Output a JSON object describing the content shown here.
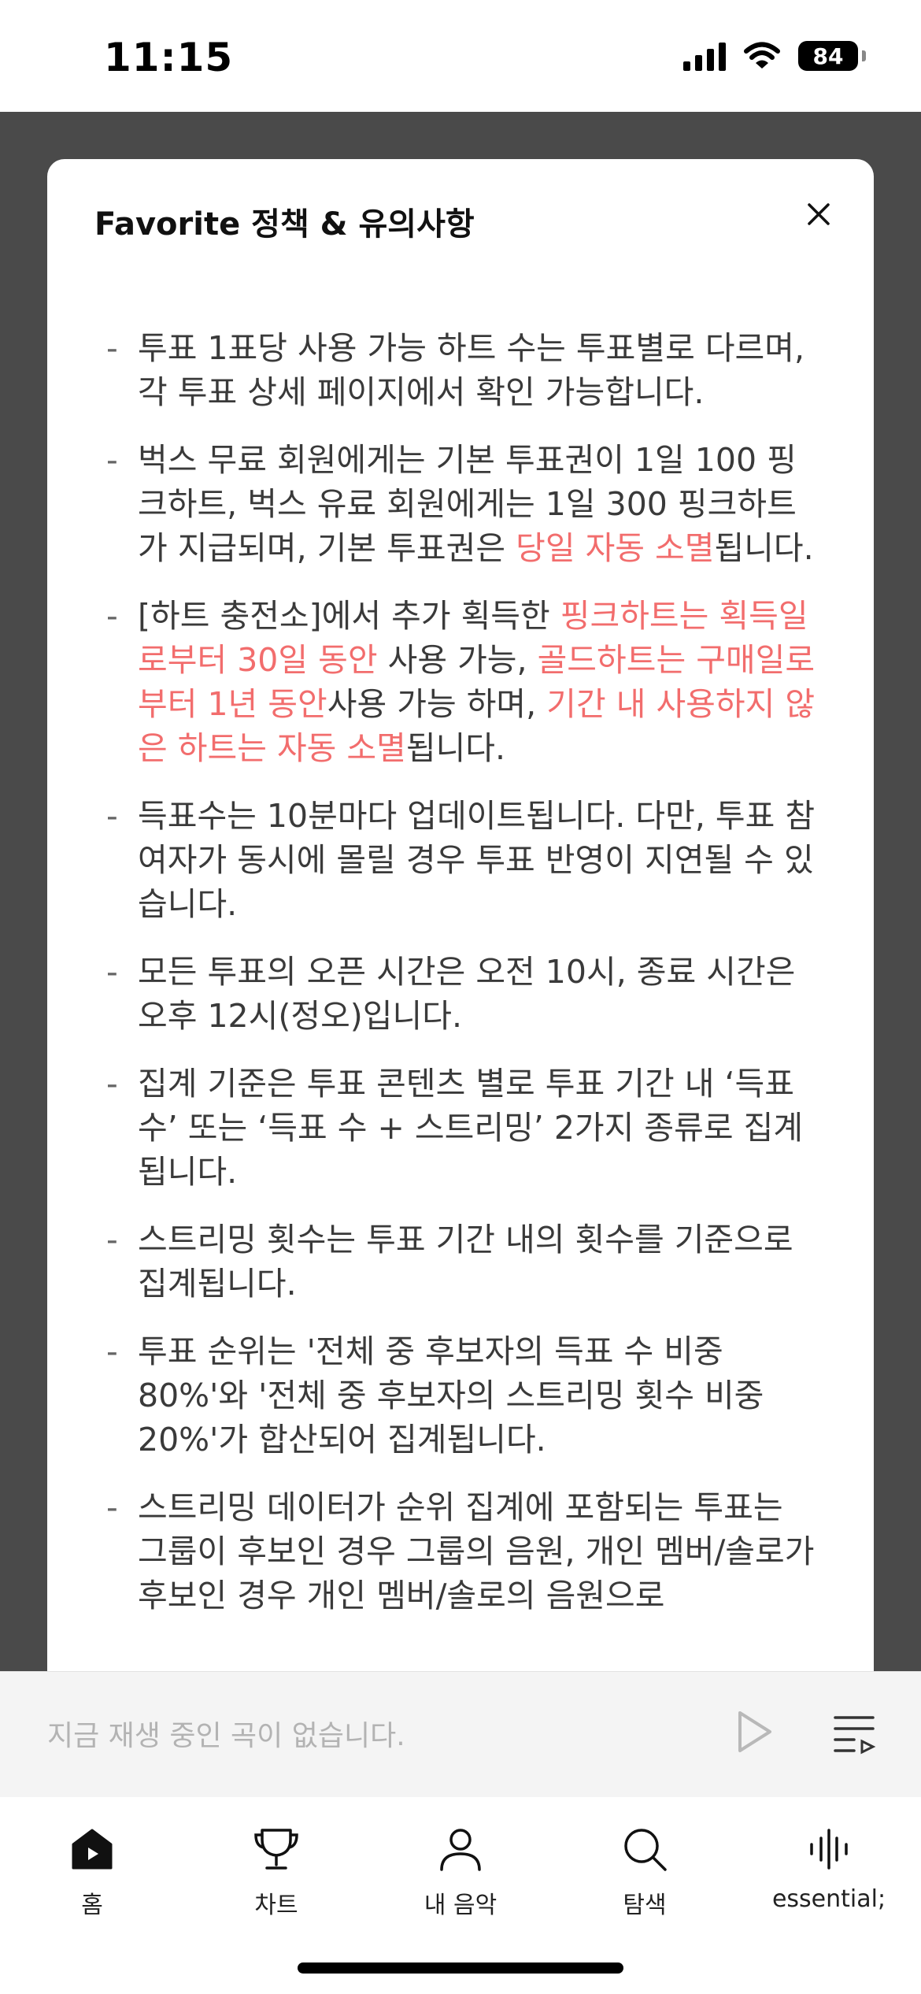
{
  "status_bar": {
    "time": "11:15",
    "battery": "84"
  },
  "modal": {
    "title": "Favorite 정책 & 유의사항",
    "items": [
      [
        {
          "t": "투표 1표당 사용 가능 하트 수는 투표별로 다르며, 각 투표 상세 페이지에서 확인 가능합니다."
        }
      ],
      [
        {
          "t": "벅스 무료 회원에게는 기본 투표권이 1일 100 핑크하트, 벅스 유료 회원에게는 1일 300 핑크하트가 지급되며, 기본 투표권은 "
        },
        {
          "t": "당일 자동 소멸",
          "hl": true
        },
        {
          "t": "됩니다."
        }
      ],
      [
        {
          "t": "[하트 충전소]에서 추가 획득한 "
        },
        {
          "t": "핑크하트는 획득일로부터 30일 동안",
          "hl": true
        },
        {
          "t": " 사용 가능, "
        },
        {
          "t": "골드하트는 구매일로부터 1년 동안",
          "hl": true
        },
        {
          "t": "사용 가능 하며, "
        },
        {
          "t": "기간 내 사용하지 않은 하트는 자동 소멸",
          "hl": true
        },
        {
          "t": "됩니다."
        }
      ],
      [
        {
          "t": "득표수는 10분마다 업데이트됩니다. 다만, 투표 참여자가 동시에 몰릴 경우 투표 반영이 지연될 수 있습니다."
        }
      ],
      [
        {
          "t": "모든 투표의 오픈 시간은 오전 10시, 종료 시간은 오후 12시(정오)입니다."
        }
      ],
      [
        {
          "t": "집계 기준은 투표 콘텐츠 별로 투표 기간 내 ‘득표 수’ 또는 ‘득표 수 + 스트리밍’ 2가지 종류로 집계됩니다."
        }
      ],
      [
        {
          "t": "스트리밍 횟수는 투표 기간 내의 횟수를 기준으로 집계됩니다."
        }
      ],
      [
        {
          "t": "투표 순위는 '전체 중 후보자의 득표 수 비중 80%'와 '전체 중 후보자의 스트리밍 횟수 비중 20%'가 합산되어 집계됩니다."
        }
      ],
      [
        {
          "t": "스트리밍 데이터가 순위 집계에 포함되는 투표는 그룹이 후보인 경우 그룹의 음원, 개인 멤버/솔로가 후보인 경우 개인 멤버/솔로의 음원으로"
        }
      ]
    ]
  },
  "mini_player": {
    "now_playing": "지금 재생 중인 곡이 없습니다."
  },
  "tabs": [
    {
      "label": "홈",
      "icon": "home-icon"
    },
    {
      "label": "차트",
      "icon": "trophy-icon"
    },
    {
      "label": "내 음악",
      "icon": "person-icon"
    },
    {
      "label": "탐색",
      "icon": "search-icon"
    },
    {
      "label": "essential;",
      "icon": "soundwave-icon"
    }
  ],
  "colors": {
    "highlight": "#f26d6d",
    "backdrop": "#4a4a4a",
    "body_text": "#3a3a3a"
  }
}
